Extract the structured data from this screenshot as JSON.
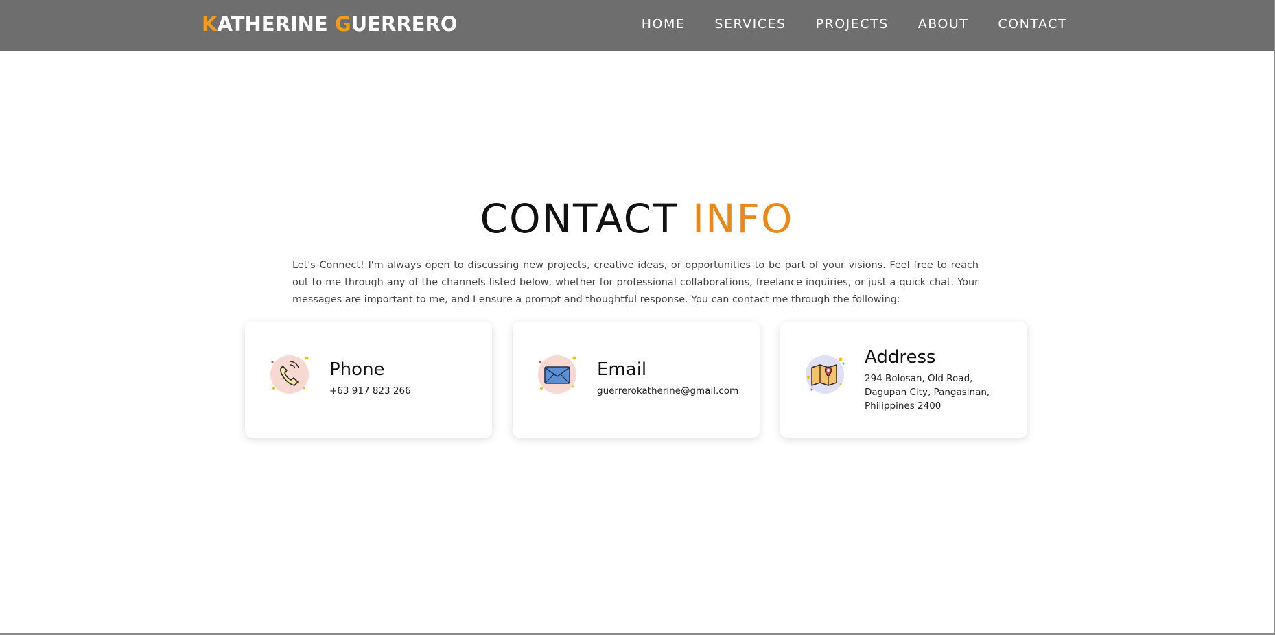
{
  "brand": {
    "first_initial": "K",
    "first_rest": "ATHERINE ",
    "last_initial": "G",
    "last_rest": "UERRERO"
  },
  "nav": {
    "items": [
      "HOME",
      "SERVICES",
      "PROJECTS",
      "ABOUT",
      "CONTACT"
    ]
  },
  "contact": {
    "title_main": "CONTACT",
    "title_accent": "INFO",
    "intro": "Let's Connect! I'm always open to discussing new projects, creative ideas, or opportunities to be part of your visions. Feel free to reach out to me through any of the channels listed below, whether for professional collaborations, freelance inquiries, or just a quick chat. Your messages are important to me, and I ensure a prompt and thoughtful response. You can contact me through the following:",
    "cards": [
      {
        "icon": "phone-icon",
        "title": "Phone",
        "detail": "+63 917 823 266"
      },
      {
        "icon": "envelope-icon",
        "title": "Email",
        "detail": "guerrerokatherine@gmail.com"
      },
      {
        "icon": "map-pin-icon",
        "title": "Address",
        "detail_lines": [
          "294 Bolosan, Old Road,",
          "Dagupan City, Pangasinan,",
          "Philippines 2400"
        ]
      }
    ]
  },
  "colors": {
    "navbar_bg": "#6e6e6e",
    "accent": "#e8891a",
    "brand_accent": "#f39b1c",
    "icon_circle_pink": "#f8d9d2",
    "icon_circle_lavender": "#dfe0f3"
  }
}
